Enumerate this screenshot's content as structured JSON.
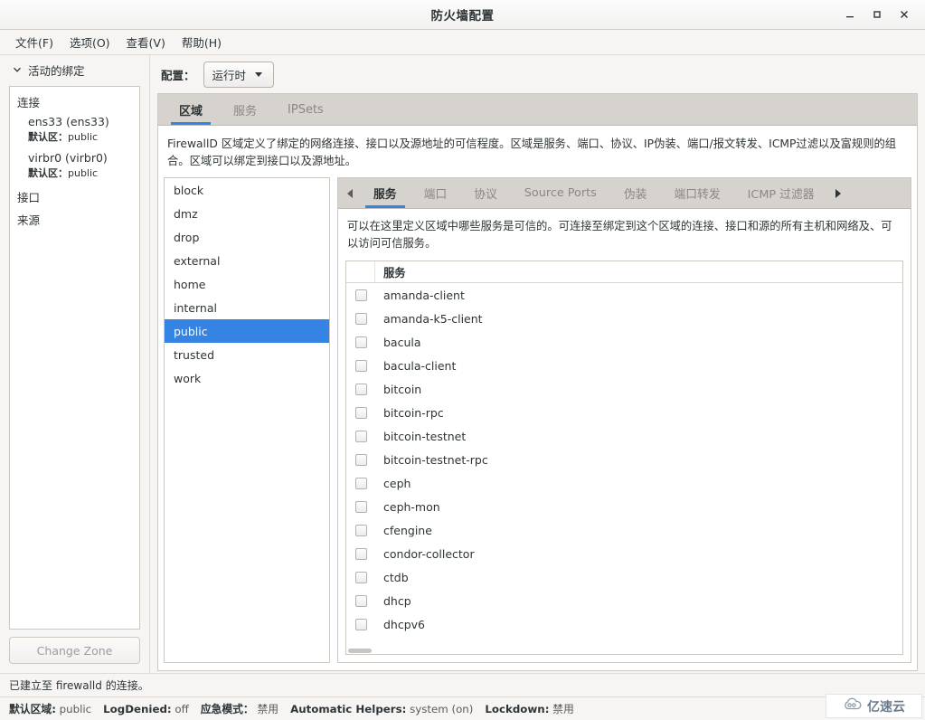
{
  "window": {
    "title": "防火墙配置",
    "minimize_label": "minimize",
    "maximize_label": "maximize",
    "close_label": "close"
  },
  "menubar": {
    "items": [
      {
        "label": "文件(F)"
      },
      {
        "label": "选项(O)"
      },
      {
        "label": "查看(V)"
      },
      {
        "label": "帮助(H)"
      }
    ]
  },
  "sidebar": {
    "header": "活动的绑定",
    "groups": [
      {
        "label": "连接"
      },
      {
        "label": "接口"
      },
      {
        "label": "来源"
      }
    ],
    "connections": [
      {
        "name": "ens33 (ens33)",
        "zone_label": "默认区",
        "zone_sep": "：",
        "zone_value": "public"
      },
      {
        "name": "virbr0 (virbr0)",
        "zone_label": "默认区",
        "zone_sep": "：",
        "zone_value": "public"
      }
    ],
    "change_zone_button": "Change Zone"
  },
  "toolbar": {
    "config_label": "配置：",
    "config_value": "运行时"
  },
  "main_tabs": [
    {
      "label": "区域",
      "active": true
    },
    {
      "label": "服务",
      "active": false
    },
    {
      "label": "IPSets",
      "active": false
    }
  ],
  "zone_description": "FirewallD 区域定义了绑定的网络连接、接口以及源地址的可信程度。区域是服务、端口、协议、IP伪装、端口/报文转发、ICMP过滤以及富规则的组合。区域可以绑定到接口以及源地址。",
  "zones": [
    {
      "name": "block",
      "selected": false
    },
    {
      "name": "dmz",
      "selected": false
    },
    {
      "name": "drop",
      "selected": false
    },
    {
      "name": "external",
      "selected": false
    },
    {
      "name": "home",
      "selected": false
    },
    {
      "name": "internal",
      "selected": false
    },
    {
      "name": "public",
      "selected": true
    },
    {
      "name": "trusted",
      "selected": false
    },
    {
      "name": "work",
      "selected": false
    }
  ],
  "inner_tabs": {
    "scroll_left": "◄",
    "scroll_right": "►",
    "items": [
      {
        "label": "服务",
        "active": true
      },
      {
        "label": "端口",
        "active": false
      },
      {
        "label": "协议",
        "active": false
      },
      {
        "label": "Source Ports",
        "active": false
      },
      {
        "label": "伪装",
        "active": false
      },
      {
        "label": "端口转发",
        "active": false
      },
      {
        "label": "ICMP 过滤器",
        "active": false
      }
    ]
  },
  "services_description": "可以在这里定义区域中哪些服务是可信的。可连接至绑定到这个区域的连接、接口和源的所有主机和网络及、可以访问可信服务。",
  "services_table": {
    "columns": [
      "",
      "服务"
    ],
    "rows": [
      {
        "name": "amanda-client",
        "checked": false
      },
      {
        "name": "amanda-k5-client",
        "checked": false
      },
      {
        "name": "bacula",
        "checked": false
      },
      {
        "name": "bacula-client",
        "checked": false
      },
      {
        "name": "bitcoin",
        "checked": false
      },
      {
        "name": "bitcoin-rpc",
        "checked": false
      },
      {
        "name": "bitcoin-testnet",
        "checked": false
      },
      {
        "name": "bitcoin-testnet-rpc",
        "checked": false
      },
      {
        "name": "ceph",
        "checked": false
      },
      {
        "name": "ceph-mon",
        "checked": false
      },
      {
        "name": "cfengine",
        "checked": false
      },
      {
        "name": "condor-collector",
        "checked": false
      },
      {
        "name": "ctdb",
        "checked": false
      },
      {
        "name": "dhcp",
        "checked": false
      },
      {
        "name": "dhcpv6",
        "checked": false
      }
    ]
  },
  "status": {
    "connection_message": "已建立至 firewalld 的连接。",
    "fields": [
      {
        "label": "默认区域:",
        "value": "public"
      },
      {
        "label": "LogDenied:",
        "value": "off"
      },
      {
        "label": "应急模式：",
        "value": "禁用"
      },
      {
        "label": "Automatic Helpers:",
        "value": "system (on)"
      },
      {
        "label": "Lockdown:",
        "value": "禁用"
      }
    ]
  },
  "watermark": {
    "text": "亿速云"
  },
  "colors": {
    "accent": "#3584e4",
    "selection": "#3584e4",
    "window_bg": "#f6f5f4",
    "tabbar_bg": "#d6d2ce",
    "border": "#cdc7c2"
  }
}
